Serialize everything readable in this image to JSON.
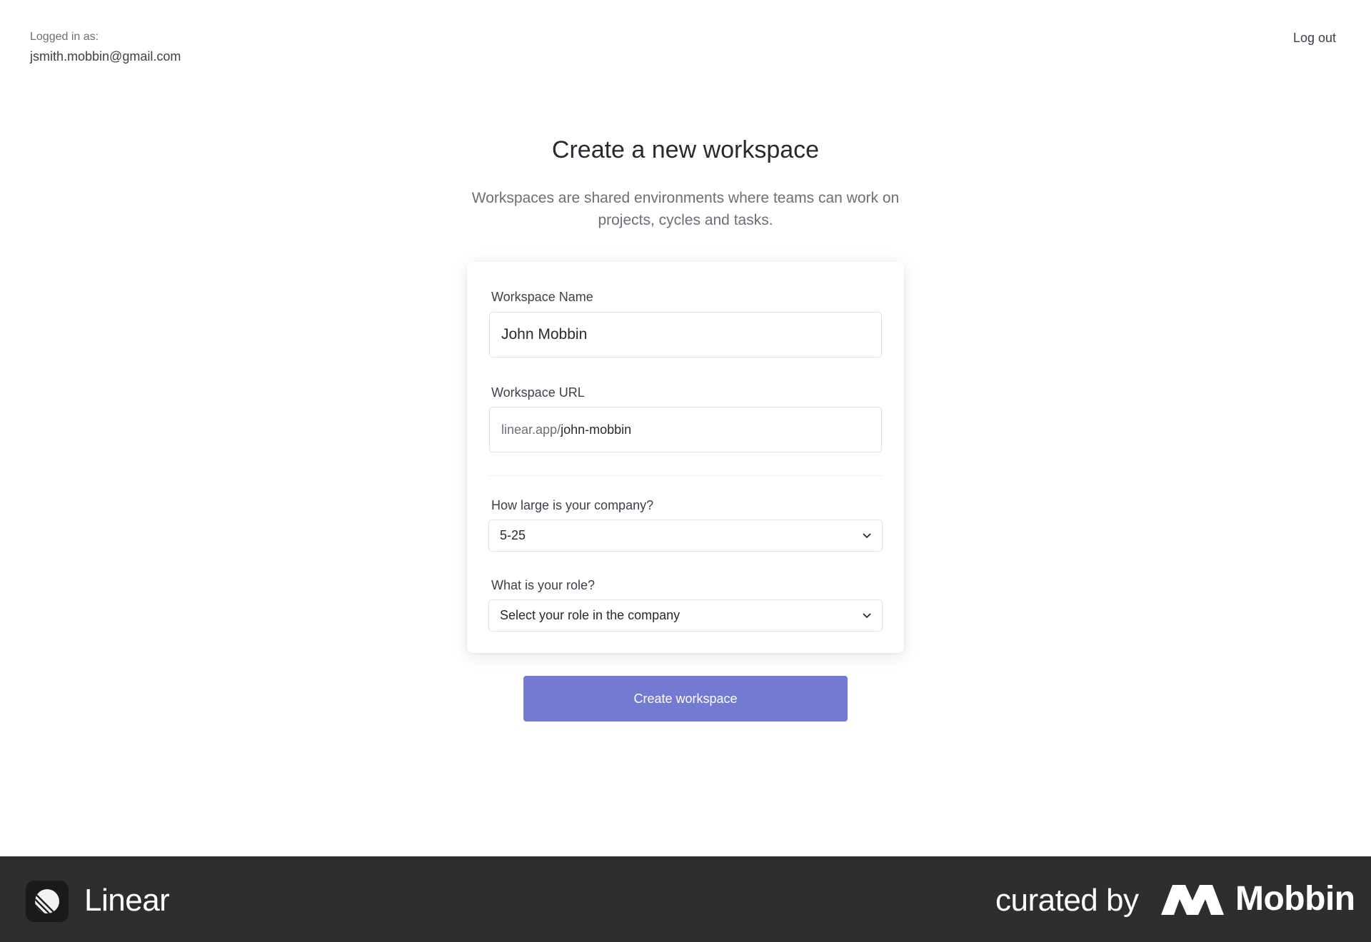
{
  "header": {
    "login_label": "Logged in as:",
    "login_email": "jsmith.mobbin@gmail.com",
    "logout_label": "Log out"
  },
  "main": {
    "title": "Create a new workspace",
    "subtitle": "Workspaces are shared environments where teams can work on projects, cycles and tasks."
  },
  "form": {
    "workspace_name": {
      "label": "Workspace Name",
      "value": "John Mobbin"
    },
    "workspace_url": {
      "label": "Workspace URL",
      "prefix": "linear.app/",
      "value": "john-mobbin"
    },
    "company_size": {
      "label": "How large is your company?",
      "selected": "5-25"
    },
    "role": {
      "label": "What is your role?",
      "selected": "Select your role in the company"
    },
    "submit_label": "Create workspace"
  },
  "footer": {
    "app_name": "Linear",
    "curated_label": "curated by",
    "brand_name": "Mobbin"
  },
  "colors": {
    "accent": "#727ad2",
    "footer_bg": "#2e2e2e",
    "text_primary": "#282a30",
    "text_secondary": "#6b6f76"
  },
  "icons": {
    "app_logo": "linear-logo-icon",
    "brand_logo": "mobbin-logo-icon",
    "select_indicator": "chevron-down-icon"
  }
}
